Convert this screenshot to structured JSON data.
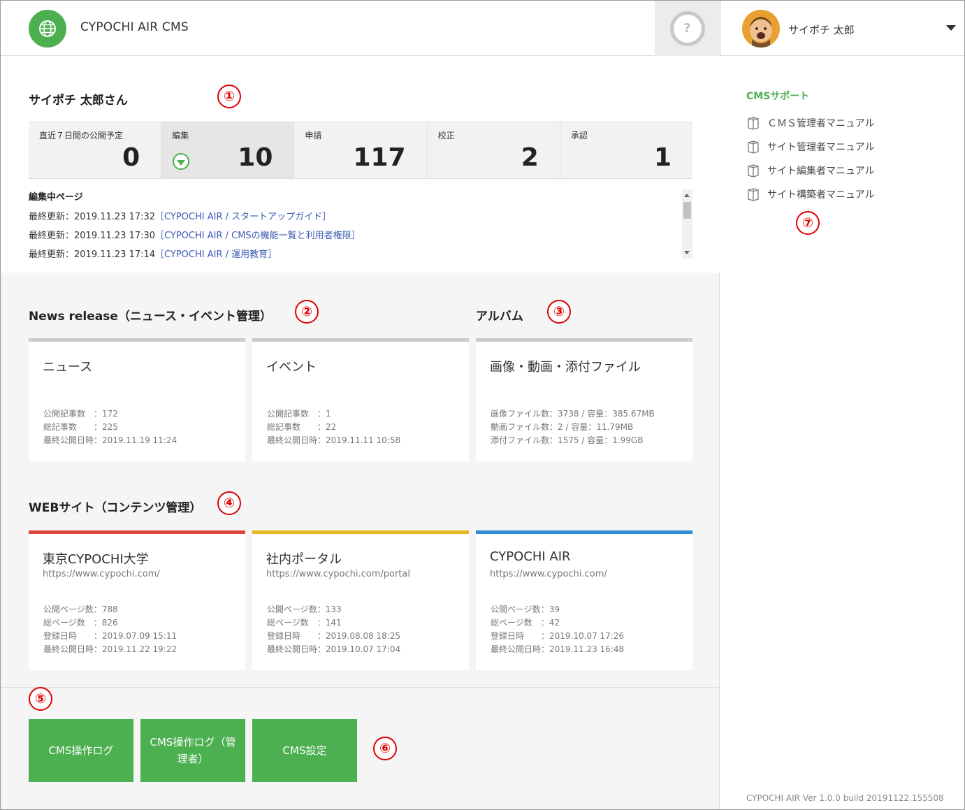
{
  "header": {
    "app_title": "CYPOCHI AIR CMS",
    "help_label": "?",
    "user_name": "サイポチ 太郎"
  },
  "summary": {
    "greeting": "サイポチ 太郎さん",
    "marker": "①",
    "stats": [
      {
        "label": "直近７日間の公開予定",
        "value": "0"
      },
      {
        "label": "編集",
        "value": "10"
      },
      {
        "label": "申請",
        "value": "117"
      },
      {
        "label": "校正",
        "value": "2"
      },
      {
        "label": "承認",
        "value": "1"
      }
    ],
    "editing_title": "編集中ページ",
    "editing_rows": [
      {
        "time": "最終更新：2019.11.23 17:32",
        "link": "［CYPOCHI AIR / スタートアップガイド］"
      },
      {
        "time": "最終更新：2019.11.23 17:30",
        "link": "［CYPOCHI AIR / CMSの機能一覧と利用者権限］"
      },
      {
        "time": "最終更新：2019.11.23 17:14",
        "link": "［CYPOCHI AIR / 運用教育］"
      }
    ]
  },
  "news": {
    "title": "News release（ニュース・イベント管理）",
    "marker": "②",
    "cards": [
      {
        "title": "ニュース",
        "meta": "公開記事数　：172\n総記事数　　：225\n最終公開日時：2019.11.19 11:24"
      },
      {
        "title": "イベント",
        "meta": "公開記事数　：1\n総記事数　　：22\n最終公開日時：2019.11.11 10:58"
      }
    ]
  },
  "album": {
    "title": "アルバム",
    "marker": "③",
    "card": {
      "title": "画像・動画・添付ファイル",
      "meta": "画像ファイル数：3738 / 容量：385.67MB\n動画ファイル数：2 / 容量：11.79MB\n添付ファイル数：1575 / 容量：1.99GB"
    }
  },
  "websites": {
    "title": "WEBサイト（コンテンツ管理）",
    "marker": "④",
    "cards": [
      {
        "title": "東京CYPOCHI大学",
        "url": "https://www.cypochi.com/",
        "color": "#e0473a",
        "meta": "公開ページ数：788\n総ページ数　：826\n登録日時　　：2019.07.09 15:11\n最終公開日時：2019.11.22 19:22"
      },
      {
        "title": "社内ポータル",
        "url": "https://www.cypochi.com/portal",
        "color": "#e8b820",
        "meta": "公開ページ数：133\n総ページ数　：141\n登録日時　　：2019.08.08 18:25\n最終公開日時：2019.10.07 17:04"
      },
      {
        "title": "CYPOCHI AIR",
        "url": "https://www.cypochi.com/",
        "color": "#2e8fd6",
        "meta": "公開ページ数：39\n総ページ数　：42\n登録日時　　：2019.10.07 17:26\n最終公開日時：2019.11.23 16:48"
      }
    ]
  },
  "actions": {
    "marker5": "⑤",
    "marker6": "⑥",
    "buttons": [
      {
        "label": "CMS操作ログ"
      },
      {
        "label": "CMS操作ログ（管理者）"
      },
      {
        "label": "CMS設定"
      }
    ]
  },
  "sidebar": {
    "support_title": "CMSサポート",
    "marker": "⑦",
    "manuals": [
      {
        "label": "ＣＭＳ管理者マニュアル"
      },
      {
        "label": "サイト管理者マニュアル"
      },
      {
        "label": "サイト編集者マニュアル"
      },
      {
        "label": "サイト構築者マニュアル"
      }
    ],
    "version": "CYPOCHI AIR Ver 1.0.0 build 20191122.155508"
  },
  "colors": {
    "accent": "#4caf50",
    "marker": "#e00000",
    "link": "#3b5ab4"
  }
}
